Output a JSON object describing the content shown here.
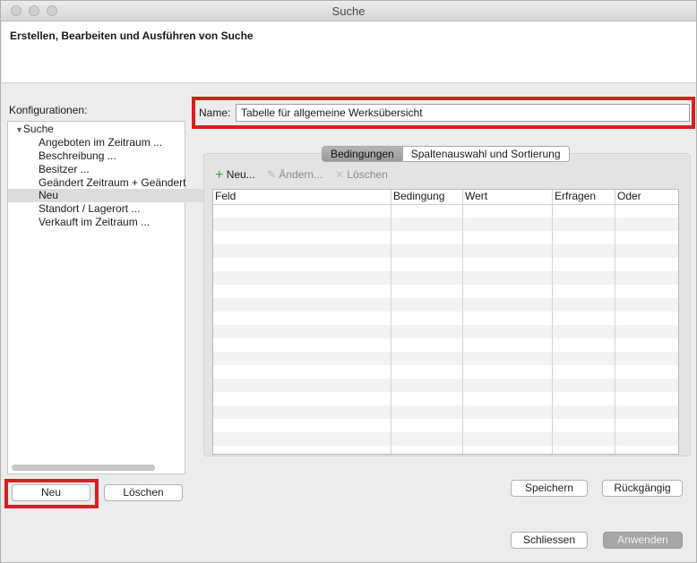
{
  "window": {
    "title": "Suche"
  },
  "header": {
    "title": "Erstellen, Bearbeiten und Ausführen von Suche"
  },
  "sidebar": {
    "label": "Konfigurationen:",
    "root": "Suche",
    "items": [
      "Angeboten im Zeitraum ...",
      "Beschreibung ...",
      "Besitzer ...",
      "Geändert Zeitraum + Geändert",
      "Neu",
      "Standort / Lagerort ...",
      "Verkauft im Zeitraum ..."
    ],
    "selected_index": 4,
    "new_button": "Neu",
    "delete_button": "Löschen"
  },
  "name": {
    "label": "Name:",
    "value": "Tabelle für allgemeine Werksübersicht"
  },
  "tabs": [
    {
      "label": "Bedingungen",
      "active": true
    },
    {
      "label": "Spaltenauswahl und Sortierung",
      "active": false
    }
  ],
  "toolbar": {
    "new": "Neu...",
    "edit": "Ändern...",
    "delete": "Löschen"
  },
  "table": {
    "columns": [
      "Feld",
      "Bedingung",
      "Wert",
      "Erfragen",
      "Oder"
    ]
  },
  "buttons": {
    "save": "Speichern",
    "undo": "Rückgängig",
    "close": "Schliessen",
    "apply": "Anwenden"
  },
  "colors": {
    "highlight": "#d61f1f",
    "add_icon": "#3aa43a"
  }
}
